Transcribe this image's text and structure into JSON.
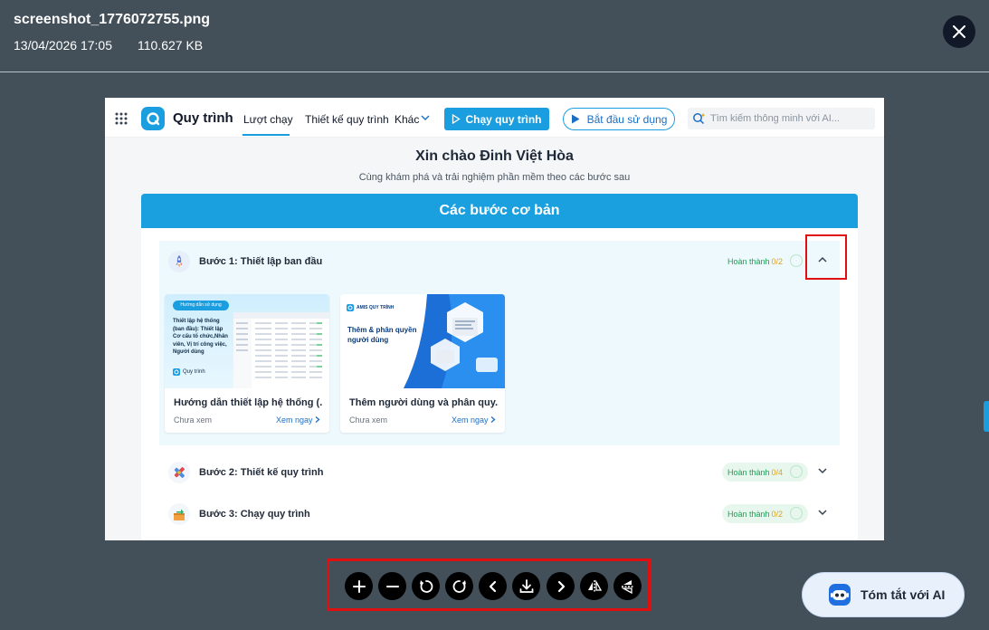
{
  "viewer": {
    "file_name": "screenshot_1776072755.png",
    "date": "13/04/2026 17:05",
    "size": "110.627 KB",
    "close_icon": "close-icon"
  },
  "app": {
    "name": "Quy trình",
    "nav": {
      "run": "Lượt chạy",
      "design": "Thiết kế quy trình",
      "other": "Khác"
    },
    "run_button": "Chạy quy trình",
    "start_button": "Bắt đầu sử dụng",
    "search_placeholder": "Tìm kiếm thông minh với AI..."
  },
  "welcome": {
    "title": "Xin chào Đinh Việt Hòa",
    "subtitle": "Cùng khám phá và trải nghiệm phần mềm theo các bước sau"
  },
  "steps": {
    "header": "Các bước cơ bản",
    "items": [
      {
        "label": "Bước 1: Thiết lập ban đầu",
        "done_label": "Hoàn thành",
        "done_frac": "0/2",
        "expanded": true
      },
      {
        "label": "Bước 2: Thiết kế quy trình",
        "done_label": "Hoàn thành",
        "done_frac": "0/4",
        "expanded": false
      },
      {
        "label": "Bước 3: Chạy quy trình",
        "done_label": "Hoàn thành",
        "done_frac": "0/2",
        "expanded": false
      }
    ],
    "videos": [
      {
        "title": "Hướng dẫn thiết lập hệ thống (...",
        "status": "Chưa xem",
        "link": "Xem ngay",
        "thumb_tag": "Hướng dẫn sử dụng",
        "thumb_text": "Thiết lập hệ thống (ban đầu): Thiết lập Cơ cấu tổ chức,Nhân viên, Vị trí công việc, Người dùng",
        "thumb_brand": "Quy trình"
      },
      {
        "title": "Thêm người dùng và phân quy...",
        "status": "Chưa xem",
        "link": "Xem ngay",
        "thumb_brand": "AMIS QUY TRÌNH",
        "thumb_text": "Thêm & phân quyền người dùng"
      }
    ]
  },
  "toolbar": {
    "buttons": [
      "zoom-in-icon",
      "zoom-out-icon",
      "rotate-left-icon",
      "rotate-right-icon",
      "prev-icon",
      "download-icon",
      "next-icon",
      "flip-horizontal-icon",
      "flip-vertical-icon"
    ]
  },
  "ai_button": {
    "label": "Tóm tắt với AI"
  },
  "colors": {
    "viewer_bg": "#435059",
    "brand": "#1a9ee0",
    "highlight": "#e01010",
    "done_green": "#1f9d55",
    "frac_orange": "#e0a21a"
  }
}
